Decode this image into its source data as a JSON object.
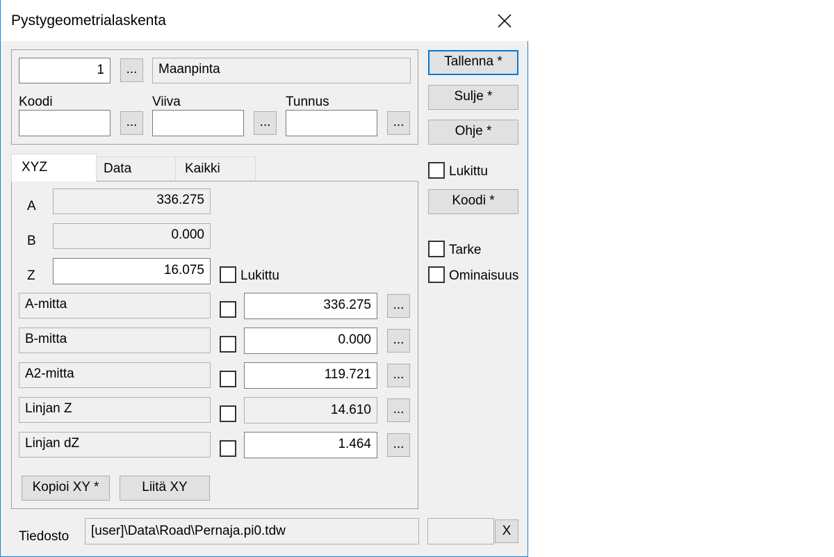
{
  "window": {
    "title": "Pystygeometrialaskenta"
  },
  "top": {
    "number": "1",
    "name": "Maanpinta",
    "koodi_label": "Koodi",
    "viiva_label": "Viiva",
    "tunnus_label": "Tunnus",
    "koodi_value": "",
    "viiva_value": "",
    "tunnus_value": ""
  },
  "ellipsis": "...",
  "tabs": [
    "XYZ",
    "Data",
    "Kaikki"
  ],
  "xyz": {
    "a_label": "A",
    "a_value": "336.275",
    "b_label": "B",
    "b_value": "0.000",
    "z_label": "Z",
    "z_value": "16.075",
    "z_lock_label": "Lukittu",
    "rows": [
      {
        "label": "A-mitta",
        "value": "336.275"
      },
      {
        "label": "B-mitta",
        "value": "0.000"
      },
      {
        "label": "A2-mitta",
        "value": "119.721"
      },
      {
        "label": "Linjan Z",
        "value": "14.610"
      },
      {
        "label": "Linjan dZ",
        "value": "1.464"
      }
    ],
    "copy_label": "Kopioi XY *",
    "paste_label": "Liitä XY"
  },
  "buttons": {
    "save": "Tallenna *",
    "close": "Sulje *",
    "help": "Ohje *",
    "code": "Koodi *"
  },
  "side": {
    "locked_label": "Lukittu",
    "tarke_label": "Tarke",
    "feature_label": "Ominaisuus"
  },
  "file": {
    "label": "Tiedosto",
    "path": "[user]\\Data\\Road\\Pernaja.pi0.tdw",
    "extra": "",
    "x_label": "X"
  },
  "colors": {
    "accent": "#0078d7",
    "window_border": "#1883d7",
    "background": "#f0f0f0"
  }
}
